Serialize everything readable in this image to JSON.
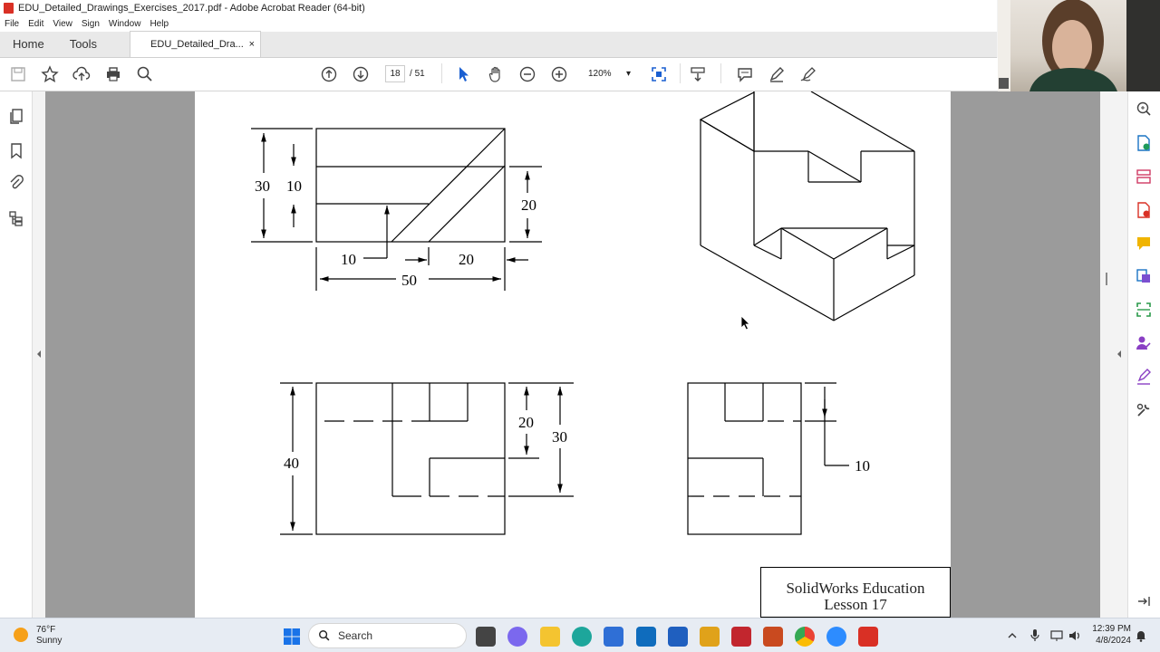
{
  "window": {
    "title": "EDU_Detailed_Drawings_Exercises_2017.pdf - Adobe Acrobat Reader (64-bit)"
  },
  "menu": [
    "File",
    "Edit",
    "View",
    "Sign",
    "Window",
    "Help"
  ],
  "tabs": {
    "home": "Home",
    "tools": "Tools",
    "document": "EDU_Detailed_Dra...",
    "close": "×"
  },
  "toolbar": {
    "current_page": "18",
    "page_separator": "/",
    "total_pages": "51",
    "zoom": "120%",
    "zoom_caret": "▾"
  },
  "drawing": {
    "dims": {
      "top_30": "30",
      "top_10": "10",
      "top_20": "20",
      "bottom_10": "10",
      "bottom_20": "20",
      "width_50": "50",
      "front_40": "40",
      "front_20": "20",
      "front_30": "30",
      "side_10": "10"
    }
  },
  "title_block": {
    "line1": "SolidWorks Education",
    "line2": "Lesson 17"
  },
  "taskbar": {
    "weather_temp": "76°F",
    "weather_desc": "Sunny",
    "search_label": "Search",
    "time": "12:39 PM",
    "date": "4/8/2024"
  },
  "colors": {
    "acrobat_red": "#d93025",
    "viewer_gray": "#9b9b9b",
    "taskbar_bg": "#e7ecf3"
  }
}
